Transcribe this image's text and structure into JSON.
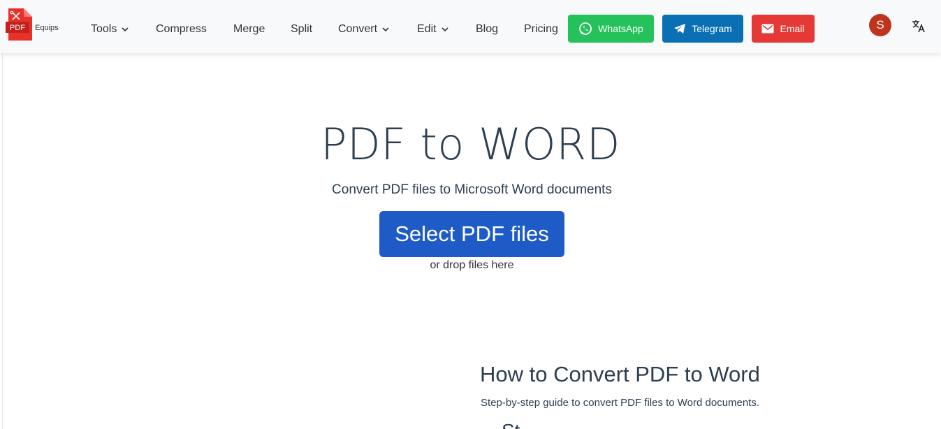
{
  "brand": {
    "logo_label": "PDF",
    "name": "Equips"
  },
  "nav": {
    "items": [
      {
        "label": "Tools",
        "dropdown": true
      },
      {
        "label": "Compress",
        "dropdown": false
      },
      {
        "label": "Merge",
        "dropdown": false
      },
      {
        "label": "Split",
        "dropdown": false
      },
      {
        "label": "Convert",
        "dropdown": true
      },
      {
        "label": "Edit",
        "dropdown": true
      },
      {
        "label": "Blog",
        "dropdown": false
      },
      {
        "label": "Pricing",
        "dropdown": false
      }
    ]
  },
  "social": {
    "whatsapp": {
      "label": "WhatsApp",
      "color": "#25c15b",
      "icon": "whatsapp-icon"
    },
    "telegram": {
      "label": "Telegram",
      "color": "#0a6fb3",
      "icon": "telegram-icon"
    },
    "email": {
      "label": "Email",
      "color": "#e53935",
      "icon": "mail-icon"
    }
  },
  "user": {
    "initial": "S",
    "color": "#c0341d"
  },
  "language_icon": "translate-icon",
  "hero": {
    "title": "PDF to WORD",
    "subtitle": "Convert PDF files to Microsoft Word documents",
    "button_label": "Select PDF files",
    "button_color": "#1e5bc6",
    "drop_hint": "or drop files here"
  },
  "guide": {
    "title": "How to Convert PDF to Word",
    "subtitle": "Step-by-step guide to convert PDF files to Word documents.",
    "next_heading_partial": "St"
  }
}
